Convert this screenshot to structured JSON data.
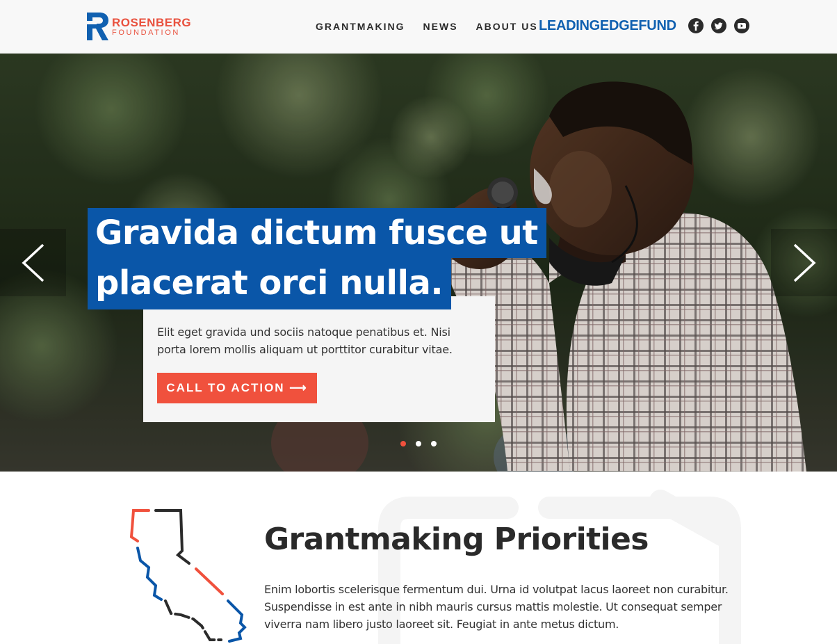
{
  "header": {
    "logo_top": "ROSENBERG",
    "logo_bottom": "FOUNDATION",
    "nav": [
      "GRANTMAKING",
      "NEWS",
      "ABOUT US"
    ],
    "leading_edge": {
      "part1": "LEADING",
      "part2": "EDGE",
      "part3": "FUND"
    },
    "socials": [
      "facebook-icon",
      "twitter-icon",
      "youtube-icon"
    ]
  },
  "hero": {
    "headline_line1": "Gravida dictum fusce ut",
    "headline_line2": "placerat orci nulla.",
    "body": "Elit eget gravida und sociis natoque penatibus et. Nisi porta lorem mollis aliquam ut porttitor curabitur vitae.",
    "cta_label": "CALL TO ACTION ⟶",
    "slides": 3,
    "active_slide": 1
  },
  "priorities": {
    "title": "Grantmaking Priorities",
    "body": "Enim lobortis scelerisque fermentum dui. Urna id volutpat lacus laoreet non curabitur. Suspendisse in est ante in nibh mauris cursus mattis molestie. Ut consequat semper viverra nam libero justo laoreet sit. Feugiat in ante metus dictum."
  },
  "colors": {
    "brand_blue": "#0a56a8",
    "brand_red": "#f0513d",
    "text_dark": "#2b2b2b"
  }
}
